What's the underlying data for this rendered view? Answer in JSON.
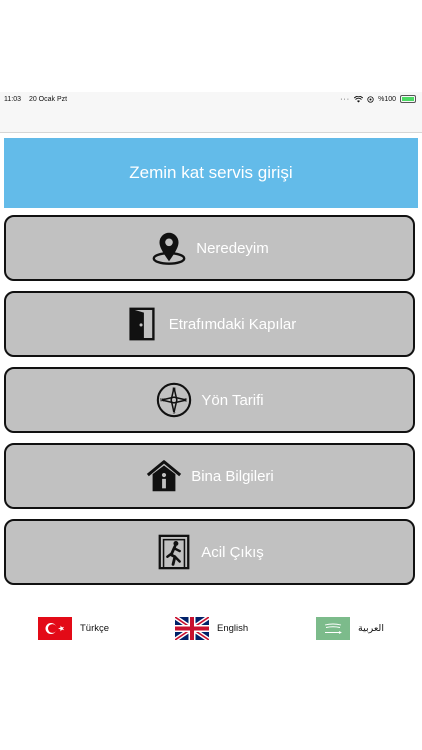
{
  "status": {
    "time": "11:03",
    "date": "20 Ocak Pzt",
    "battery": "%100",
    "battery_level": 100
  },
  "header": {
    "title": "Zemin kat servis girişi"
  },
  "menu": [
    {
      "label": "Neredeyim",
      "icon": "location-pin-icon"
    },
    {
      "label": "Etrafımdaki Kapılar",
      "icon": "door-icon"
    },
    {
      "label": "Yön Tarifi",
      "icon": "compass-icon"
    },
    {
      "label": "Bina Bilgileri",
      "icon": "building-info-icon"
    },
    {
      "label": "Acil Çıkış",
      "icon": "emergency-exit-icon"
    }
  ],
  "languages": [
    {
      "label": "Türkçe",
      "flag": "turkey-flag-icon"
    },
    {
      "label": "English",
      "flag": "uk-flag-icon"
    },
    {
      "label": "العربية",
      "flag": "saudi-flag-icon"
    }
  ],
  "colors": {
    "header_bg": "#63bbe9",
    "button_bg": "#c1c1c1",
    "button_border": "#111111",
    "text_on_button": "#ffffff"
  }
}
